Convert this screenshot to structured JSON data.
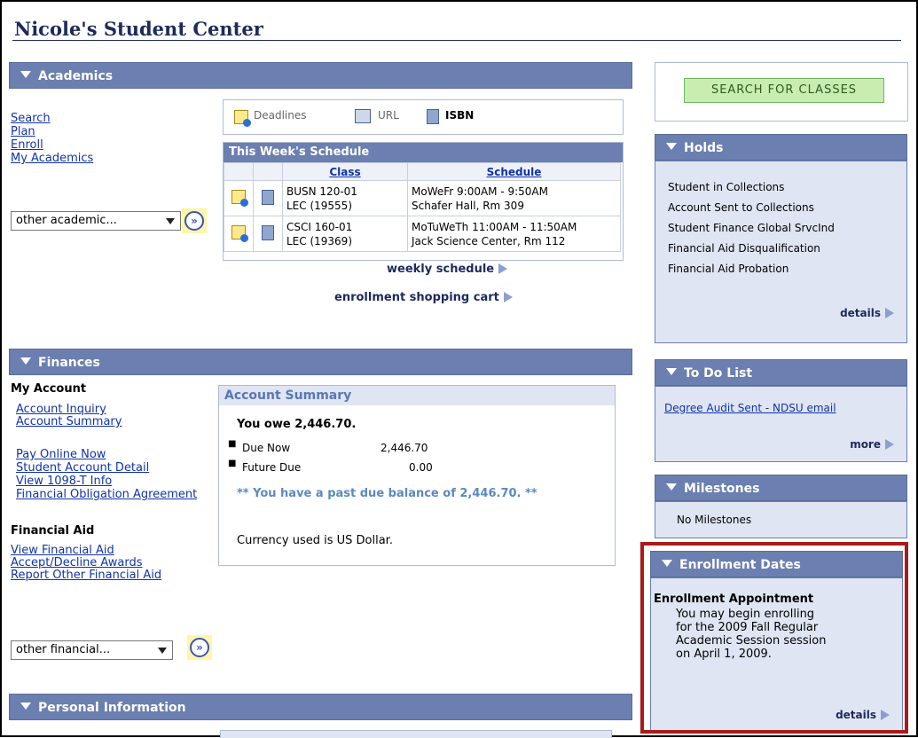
{
  "page_title": "Nicole's Student Center",
  "academics": {
    "header": "Academics",
    "links": [
      "Search",
      "Plan",
      "Enroll",
      "My Academics"
    ],
    "select_value": "other academic...",
    "toolbar": {
      "deadlines": "Deadlines",
      "url": "URL",
      "isbn": "ISBN"
    },
    "schedule": {
      "title": "This Week's Schedule",
      "col_class": "Class",
      "col_schedule": "Schedule",
      "rows": [
        {
          "class_code": "BUSN 120-01",
          "class_type": "LEC (19555)",
          "time": "MoWeFr 9:00AM - 9:50AM",
          "room": "Schafer Hall, Rm 309"
        },
        {
          "class_code": "CSCI 160-01",
          "class_type": "LEC (19369)",
          "time": "MoTuWeTh 11:00AM - 11:50AM",
          "room": "Jack Science Center, Rm 112"
        }
      ]
    },
    "weekly_schedule": "weekly schedule",
    "shopping_cart": "enrollment shopping cart"
  },
  "finances": {
    "header": "Finances",
    "my_account": "My Account",
    "account_links_1": [
      "Account Inquiry",
      "Account Summary"
    ],
    "account_links_2": [
      "Pay Online Now",
      "Student Account Detail",
      "View 1098-T Info",
      "Financial Obligation Agreement"
    ],
    "financial_aid": "Financial Aid",
    "aid_links": [
      "View Financial Aid",
      "Accept/Decline Awards",
      "Report Other Financial Aid"
    ],
    "select_value": "other financial...",
    "summary": {
      "title": "Account Summary",
      "you_owe": "You owe 2,446.70.",
      "due_now_label": "Due Now",
      "due_now_value": "2,446.70",
      "future_due_label": "Future Due",
      "future_due_value": "0.00",
      "past_due_msg": "** You have a past due balance of 2,446.70. **",
      "currency": "Currency used is US Dollar."
    }
  },
  "personal": {
    "header": "Personal Information"
  },
  "sidebar": {
    "search_button": "SEARCH FOR CLASSES",
    "holds": {
      "header": "Holds",
      "items": [
        "Student in Collections",
        "Account Sent to Collections",
        "Student Finance Global SrvcInd",
        "Financial Aid Disqualification",
        "Financial Aid Probation"
      ],
      "details": "details"
    },
    "todo": {
      "header": "To Do List",
      "item": "Degree Audit Sent - NDSU email",
      "more": "more"
    },
    "milestones": {
      "header": "Milestones",
      "text": "No Milestones"
    },
    "enrollment_dates": {
      "header": "Enrollment Dates",
      "appointment_title": "Enrollment Appointment",
      "lines": [
        "You may begin enrolling",
        "for the 2009 Fall Regular",
        "Academic Session session",
        "on April 1, 2009."
      ],
      "details": "details"
    }
  },
  "colors": {
    "header_bar": "#6b7fb0",
    "title": "#1d2a5b",
    "link": "#1133aa",
    "highlight_box": "#aa1a1a",
    "search_button": "#b9e4a4"
  }
}
